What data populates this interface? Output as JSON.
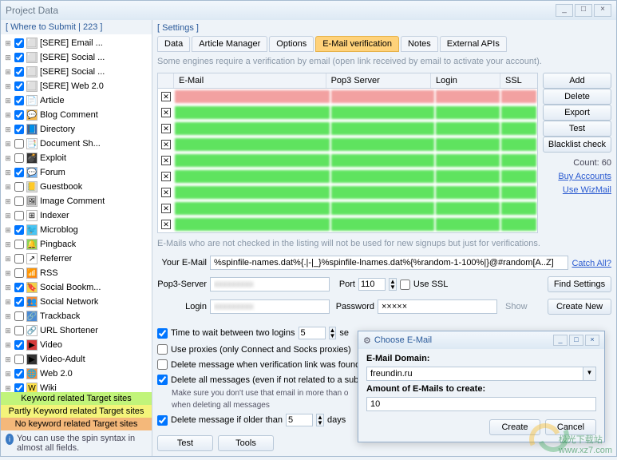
{
  "window": {
    "title": "Project Data"
  },
  "sidebar": {
    "header": "[ Where to Submit | 223 ]",
    "items": [
      {
        "checked": true,
        "icon": "⬜",
        "iconbg": "#ddd",
        "label": "[SERE] Email ..."
      },
      {
        "checked": true,
        "icon": "⬜",
        "iconbg": "#ddd",
        "label": "[SERE] Social ..."
      },
      {
        "checked": true,
        "icon": "⬜",
        "iconbg": "#ddd",
        "label": "[SERE] Social ..."
      },
      {
        "checked": true,
        "icon": "⬜",
        "iconbg": "#ddd",
        "label": "[SERE] Web 2.0"
      },
      {
        "checked": true,
        "icon": "📄",
        "iconbg": "#fff",
        "label": "Article"
      },
      {
        "checked": true,
        "icon": "💬",
        "iconbg": "#f7b84a",
        "label": "Blog Comment"
      },
      {
        "checked": true,
        "icon": "📘",
        "iconbg": "#3a6ab4",
        "label": "Directory"
      },
      {
        "checked": false,
        "icon": "📑",
        "iconbg": "#fff",
        "label": "Document Sh..."
      },
      {
        "checked": false,
        "icon": "💣",
        "iconbg": "#333",
        "label": "Exploit"
      },
      {
        "checked": true,
        "icon": "💬",
        "iconbg": "#7ab6f2",
        "label": "Forum"
      },
      {
        "checked": false,
        "icon": "📒",
        "iconbg": "#ddd",
        "label": "Guestbook"
      },
      {
        "checked": false,
        "icon": "🖼",
        "iconbg": "#ddd",
        "label": "Image Comment"
      },
      {
        "checked": false,
        "icon": "⊞",
        "iconbg": "#fff",
        "label": "Indexer"
      },
      {
        "checked": true,
        "icon": "🐦",
        "iconbg": "#4ac4f2",
        "label": "Microblog"
      },
      {
        "checked": false,
        "icon": "🔔",
        "iconbg": "#8ad45a",
        "label": "Pingback"
      },
      {
        "checked": false,
        "icon": "↗",
        "iconbg": "#fff",
        "label": "Referrer"
      },
      {
        "checked": false,
        "icon": "📶",
        "iconbg": "#f28a3a",
        "label": "RSS"
      },
      {
        "checked": true,
        "icon": "🔖",
        "iconbg": "#f2d24a",
        "label": "Social Bookm..."
      },
      {
        "checked": true,
        "icon": "👥",
        "iconbg": "#f28a3a",
        "label": "Social Network"
      },
      {
        "checked": false,
        "icon": "🔗",
        "iconbg": "#4a8ad4",
        "label": "Trackback"
      },
      {
        "checked": false,
        "icon": "🔗",
        "iconbg": "#fff",
        "label": "URL Shortener"
      },
      {
        "checked": true,
        "icon": "▶",
        "iconbg": "#d43a3a",
        "label": "Video"
      },
      {
        "checked": false,
        "icon": "▶",
        "iconbg": "#333",
        "label": "Video-Adult"
      },
      {
        "checked": true,
        "icon": "🌐",
        "iconbg": "#f28a3a",
        "label": "Web 2.0"
      },
      {
        "checked": true,
        "icon": "W",
        "iconbg": "#ffe14a",
        "label": "Wiki"
      }
    ],
    "legend": {
      "l1": "Keyword related Target sites",
      "l2": "Partly Keyword related Target sites",
      "l3": "No keyword related Target sites"
    },
    "tip": "You can use the spin syntax in almost all fields."
  },
  "main": {
    "settingsLabel": "[ Settings ]",
    "tabs": [
      "Data",
      "Article Manager",
      "Options",
      "E-Mail verification",
      "Notes",
      "External APIs"
    ],
    "activeTab": 3,
    "hint": "Some engines require a verification by email (open link received by email to activate your account).",
    "table": {
      "cols": [
        "E-Mail",
        "Pop3 Server",
        "Login",
        "SSL"
      ],
      "rows": [
        {
          "kind": "red"
        },
        {
          "kind": "green"
        },
        {
          "kind": "green"
        },
        {
          "kind": "green"
        },
        {
          "kind": "green"
        },
        {
          "kind": "green"
        },
        {
          "kind": "green"
        },
        {
          "kind": "green"
        },
        {
          "kind": "green"
        }
      ]
    },
    "sideButtons": [
      "Add",
      "Delete",
      "Export",
      "Test",
      "Blacklist check"
    ],
    "countLabel": "Count: 60",
    "links": [
      "Buy Accounts",
      "Use WizMail"
    ],
    "note2": "E-Mails who are not checked in the listing will not be used for new signups but just for verifications.",
    "form": {
      "emailLabel": "Your E-Mail",
      "emailValue": "%spinfile-names.dat%{.|-|_}%spinfile-lnames.dat%{%random-1-100%|}@#random[A..Z]",
      "catchall": "Catch All?",
      "pop3Label": "Pop3-Server",
      "pop3Value": "blurred",
      "portLabel": "Port",
      "portValue": "110",
      "usessl": "Use SSL",
      "findsettings": "Find Settings",
      "loginLabel": "Login",
      "loginValue": "blurred",
      "pwLabel": "Password",
      "pwValue": "×××××",
      "show": "Show",
      "createnew": "Create New"
    },
    "opts": {
      "o1": "Time to wait between two logins",
      "o1val": "5",
      "o1unit": "se",
      "o2": "Use proxies (only Connect and Socks proxies)",
      "o3": "Delete message when verification link was found",
      "o4": "Delete all messages (even if not related to a subm",
      "o4b": "Make sure you don't use that email in more than o",
      "o4c": "when deleting all messages",
      "o5": "Delete message if older than",
      "o5val": "5",
      "o5unit": "days"
    },
    "bottom": {
      "test": "Test",
      "tools": "Tools"
    }
  },
  "dialog": {
    "title": "Choose E-Mail",
    "domainLabel": "E-Mail Domain:",
    "domainValue": "freundin.ru",
    "amountLabel": "Amount of E-Mails to create:",
    "amountValue": "10",
    "create": "Create",
    "cancel": "Cancel"
  },
  "watermark": {
    "brand": "极光下载站",
    "url": "www.xz7.com"
  }
}
